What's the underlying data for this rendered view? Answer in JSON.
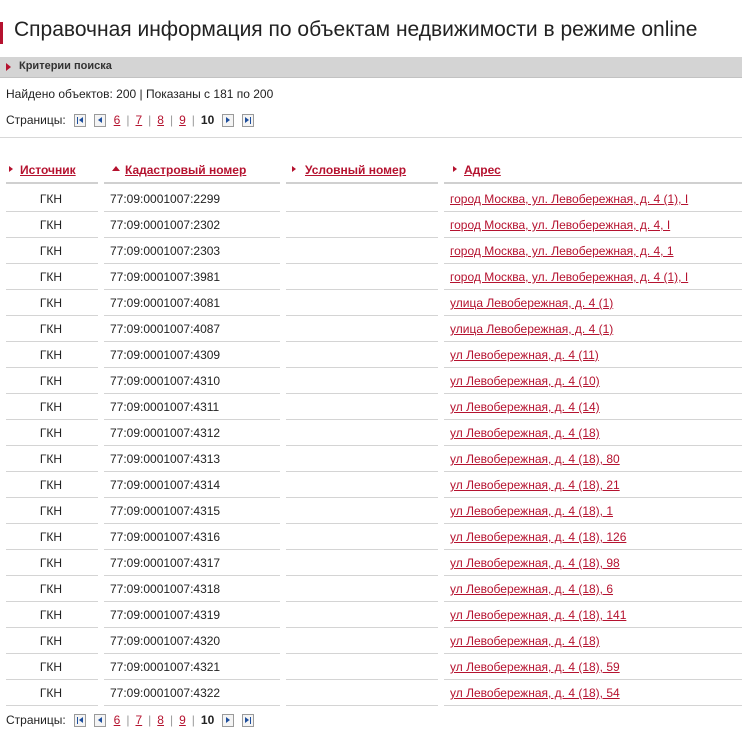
{
  "page_title": "Справочная информация по объектам недвижимости в режиме online",
  "criteria_label": "Критерии поиска",
  "found_text": "Найдено объектов: 200 | Показаны с 181 по 200",
  "pager": {
    "label": "Страницы:",
    "pages": [
      "6",
      "7",
      "8",
      "9"
    ],
    "current": "10"
  },
  "columns": {
    "source": "Источник",
    "cadastral": "Кадастровый номер",
    "conditional": "Условный номер",
    "address": "Адрес"
  },
  "colors": {
    "accent": "#b5122f",
    "pager_icon": "#1e4e9c",
    "bar_gray": "#d4d4d4"
  },
  "icons": {
    "first": "first-page-icon",
    "prev": "previous-page-icon",
    "next": "next-page-icon",
    "last": "last-page-icon",
    "sort_asc": "sort-ascending-icon",
    "expand": "triangle-right-icon"
  },
  "rows": [
    {
      "source": "ГКН",
      "cadastral": "77:09:0001007:2299",
      "conditional": "",
      "address": "город Москва, ул. Левобережная, д. 4 (1), I"
    },
    {
      "source": "ГКН",
      "cadastral": "77:09:0001007:2302",
      "conditional": "",
      "address": "город Москва, ул. Левобережная, д. 4, I"
    },
    {
      "source": "ГКН",
      "cadastral": "77:09:0001007:2303",
      "conditional": "",
      "address": "город Москва, ул. Левобережная, д. 4, 1"
    },
    {
      "source": "ГКН",
      "cadastral": "77:09:0001007:3981",
      "conditional": "",
      "address": "город Москва, ул. Левобережная, д. 4 (1), I"
    },
    {
      "source": "ГКН",
      "cadastral": "77:09:0001007:4081",
      "conditional": "",
      "address": "улица Левобережная, д. 4 (1)"
    },
    {
      "source": "ГКН",
      "cadastral": "77:09:0001007:4087",
      "conditional": "",
      "address": "улица Левобережная, д. 4 (1)"
    },
    {
      "source": "ГКН",
      "cadastral": "77:09:0001007:4309",
      "conditional": "",
      "address": "ул Левобережная, д. 4 (11)"
    },
    {
      "source": "ГКН",
      "cadastral": "77:09:0001007:4310",
      "conditional": "",
      "address": "ул Левобережная, д. 4 (10)"
    },
    {
      "source": "ГКН",
      "cadastral": "77:09:0001007:4311",
      "conditional": "",
      "address": "ул Левобережная, д. 4 (14)"
    },
    {
      "source": "ГКН",
      "cadastral": "77:09:0001007:4312",
      "conditional": "",
      "address": "ул Левобережная, д. 4 (18)"
    },
    {
      "source": "ГКН",
      "cadastral": "77:09:0001007:4313",
      "conditional": "",
      "address": "ул Левобережная, д. 4 (18), 80"
    },
    {
      "source": "ГКН",
      "cadastral": "77:09:0001007:4314",
      "conditional": "",
      "address": "ул Левобережная, д. 4 (18), 21"
    },
    {
      "source": "ГКН",
      "cadastral": "77:09:0001007:4315",
      "conditional": "",
      "address": "ул Левобережная, д. 4 (18), 1"
    },
    {
      "source": "ГКН",
      "cadastral": "77:09:0001007:4316",
      "conditional": "",
      "address": "ул Левобережная, д. 4 (18), 126"
    },
    {
      "source": "ГКН",
      "cadastral": "77:09:0001007:4317",
      "conditional": "",
      "address": "ул Левобережная, д. 4 (18), 98"
    },
    {
      "source": "ГКН",
      "cadastral": "77:09:0001007:4318",
      "conditional": "",
      "address": "ул Левобережная, д. 4 (18), 6"
    },
    {
      "source": "ГКН",
      "cadastral": "77:09:0001007:4319",
      "conditional": "",
      "address": "ул Левобережная, д. 4 (18), 141"
    },
    {
      "source": "ГКН",
      "cadastral": "77:09:0001007:4320",
      "conditional": "",
      "address": "ул Левобережная, д. 4 (18)"
    },
    {
      "source": "ГКН",
      "cadastral": "77:09:0001007:4321",
      "conditional": "",
      "address": "ул Левобережная, д. 4 (18), 59"
    },
    {
      "source": "ГКН",
      "cadastral": "77:09:0001007:4322",
      "conditional": "",
      "address": "ул Левобережная, д. 4 (18), 54"
    }
  ]
}
